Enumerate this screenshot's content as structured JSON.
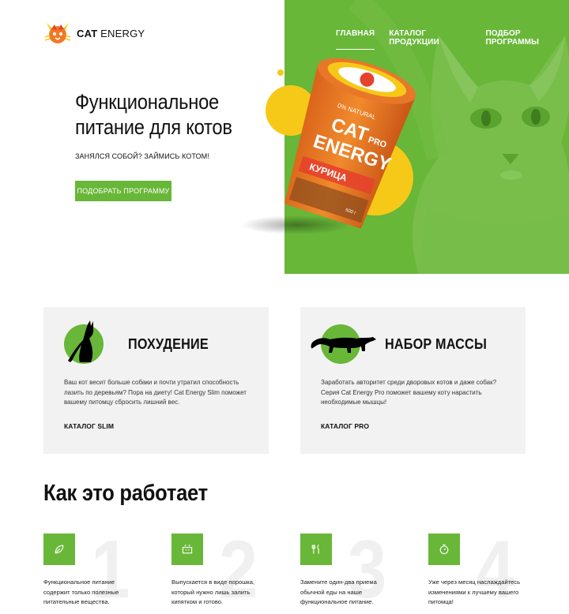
{
  "header": {
    "logo_bold": "CAT",
    "logo_rest": " ENERGY",
    "nav": [
      {
        "label": "ГЛАВНАЯ",
        "active": true
      },
      {
        "label": "КАТАЛОГ ПРОДУКЦИИ",
        "active": false
      },
      {
        "label": "ПОДБОР ПРОГРАММЫ",
        "active": false
      }
    ]
  },
  "hero": {
    "title": "Функциональное питание для котов",
    "subtitle": "ЗАНЯЛСЯ СОБОЙ? ЗАЙМИСЬ КОТОМ!",
    "button": "ПОДОБРАТЬ ПРОГРАММУ",
    "product": {
      "badge": "0% NATURAL",
      "brand_line1": "CAT",
      "pro": "PRO",
      "brand_line2": "ENERGY",
      "flavor": "КУРИЦА",
      "weight": "500 г"
    }
  },
  "cards": [
    {
      "title": "ПОХУДЕНИЕ",
      "text": "Ваш кот весит больше собаки и почти утратил способность лазить по деревьям? Пора на диету! Cat Energy Slim поможет вашему питомцу сбросить лишний вес.",
      "link": "КАТАЛОГ SLIM"
    },
    {
      "title": "НАБОР МАССЫ",
      "text": "Заработать авторитет среди дворовых котов и даже собак? Серия Cat Energy Pro поможет вашему коту нарастить необходимые мышцы!",
      "link": "КАТАЛОГ PRO"
    }
  ],
  "how": {
    "title": "Как это работает",
    "steps": [
      {
        "num": "1",
        "icon": "leaf-icon",
        "text": "Функциональное питание содержит только полезные питательные вещества."
      },
      {
        "num": "2",
        "icon": "kettle-icon",
        "text": "Выпускается в виде порошка, который нужно лишь залить кипятком и готово."
      },
      {
        "num": "3",
        "icon": "cutlery-icon",
        "text": "Замените один-два приема обычной еды на наше функциональное питание."
      },
      {
        "num": "4",
        "icon": "stopwatch-icon",
        "text": "Уже через месяц наслаждайтесь изменениями к лучшему вашего питомца!"
      }
    ]
  },
  "colors": {
    "accent": "#68b738",
    "card_bg": "#f2f2f2",
    "yellow": "#f6c918",
    "orange": "#ef7a23"
  }
}
